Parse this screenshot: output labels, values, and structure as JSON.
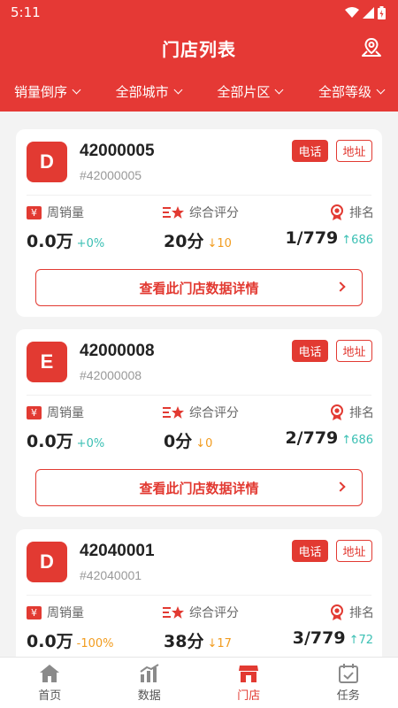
{
  "status": {
    "time": "5:11"
  },
  "header": {
    "title": "门店列表"
  },
  "filters": [
    "销量倒序",
    "全部城市",
    "全部片区",
    "全部等级"
  ],
  "labels": {
    "weekly_sales": "周销量",
    "rating": "综合评分",
    "rank": "排名",
    "phone": "电话",
    "address": "地址",
    "detail": "查看此门店数据详情"
  },
  "stores": [
    {
      "badge": "D",
      "name": "42000005",
      "code": "#42000005",
      "sales": "0.0万",
      "sales_change": "+0%",
      "score": "20分",
      "score_change": "↓10",
      "rank": "1/779",
      "rank_change": "↑686"
    },
    {
      "badge": "E",
      "name": "42000008",
      "code": "#42000008",
      "sales": "0.0万",
      "sales_change": "+0%",
      "score": "0分",
      "score_change": "↓0",
      "rank": "2/779",
      "rank_change": "↑686"
    },
    {
      "badge": "D",
      "name": "42040001",
      "code": "#42040001",
      "sales": "0.0万",
      "sales_change": "-100%",
      "score": "38分",
      "score_change": "↓17",
      "rank": "3/779",
      "rank_change": "↑72"
    }
  ],
  "tabs": [
    "首页",
    "数据",
    "门店",
    "任务"
  ],
  "colors": {
    "primary": "#e53935",
    "teal": "#3cc0b4",
    "orange": "#f29c1f"
  }
}
